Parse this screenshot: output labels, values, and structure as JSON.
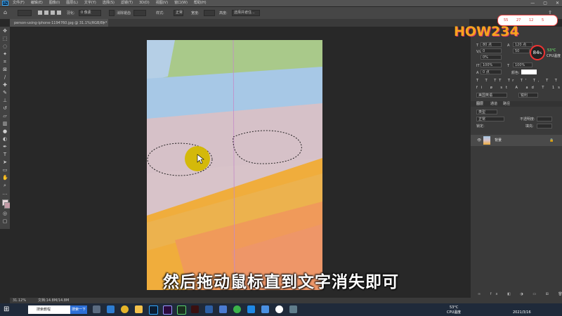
{
  "menubar": {
    "logo": "Ps",
    "items": [
      "文件(F)",
      "编辑(E)",
      "图像(I)",
      "图层(L)",
      "文字(Y)",
      "选择(S)",
      "滤镜(T)",
      "3D(D)",
      "视图(V)",
      "窗口(W)",
      "帮助(H)"
    ],
    "window_controls": [
      "—",
      "▢",
      "✕"
    ]
  },
  "options": {
    "feather_label": "羽化:",
    "feather_value": "0 像素",
    "antialias_label": "消除锯齿",
    "style_label": "样式:",
    "style_value": "正常",
    "width_label": "宽度:",
    "height_label": "高度:",
    "select_mask_label": "选择并遮住..."
  },
  "document_tab": {
    "title": "person-using-iphone-1194760.jpg @ 31.1%(RGB/8) *",
    "close": "✕"
  },
  "right_panel": {
    "char_size": "80 点",
    "leading": "120 点",
    "tracking_a": "0",
    "tracking_b": "50",
    "baseline": "0%",
    "scale_v": "100%",
    "scale_h": "100%",
    "shift": "0 点",
    "color_label": "颜色:",
    "lang": "美国英语",
    "aa": "锐利",
    "layer_tabs": [
      "图层",
      "通道",
      "路径"
    ],
    "kind_label": "类型",
    "blend": "正常",
    "opacity_label": "不透明度:",
    "lock_label": "锁定:",
    "fill_label": "填充:",
    "layer_name": "背景"
  },
  "overlay": {
    "buttons": [
      "55",
      "27",
      "12",
      "5"
    ],
    "cpu_percent": "84",
    "cpu_percent_unit": "%",
    "cpu_temp": "53°C",
    "cpu_label": "CPU温度"
  },
  "watermark": "HOW234",
  "subtitle": "然后拖动鼠标直到文字消失即可",
  "status": {
    "zoom": "31.12%",
    "doc_info": "文档:14.8M/14.8M"
  },
  "taskbar": {
    "search_placeholder": "搜索教程",
    "search_button": "搜索一下",
    "tray_temp": "53°C",
    "tray_cpu_label": "CPU温度",
    "date": "2021/3/16"
  },
  "colors": {
    "ps_blue": "#31a8ff",
    "selection_marker": "#d4b800",
    "watermark_orange": "#f7a41d"
  }
}
